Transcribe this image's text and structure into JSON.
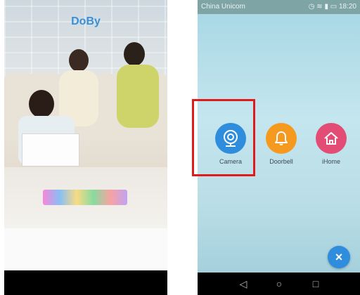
{
  "left_screen": {
    "brand": "DoBy"
  },
  "right_screen": {
    "status_bar": {
      "carrier": "China Unicom",
      "time": "18:20"
    },
    "tiles": [
      {
        "label": "Camera",
        "icon": "camera-icon",
        "color": "#2e8ddd"
      },
      {
        "label": "Doorbell",
        "icon": "bell-icon",
        "color": "#f59a1f"
      },
      {
        "label": "iHome",
        "icon": "home-icon",
        "color": "#e34c74"
      }
    ],
    "highlight_color": "#e01b1b",
    "close_button": {
      "icon": "close-icon",
      "color": "#2e8ddd"
    }
  }
}
